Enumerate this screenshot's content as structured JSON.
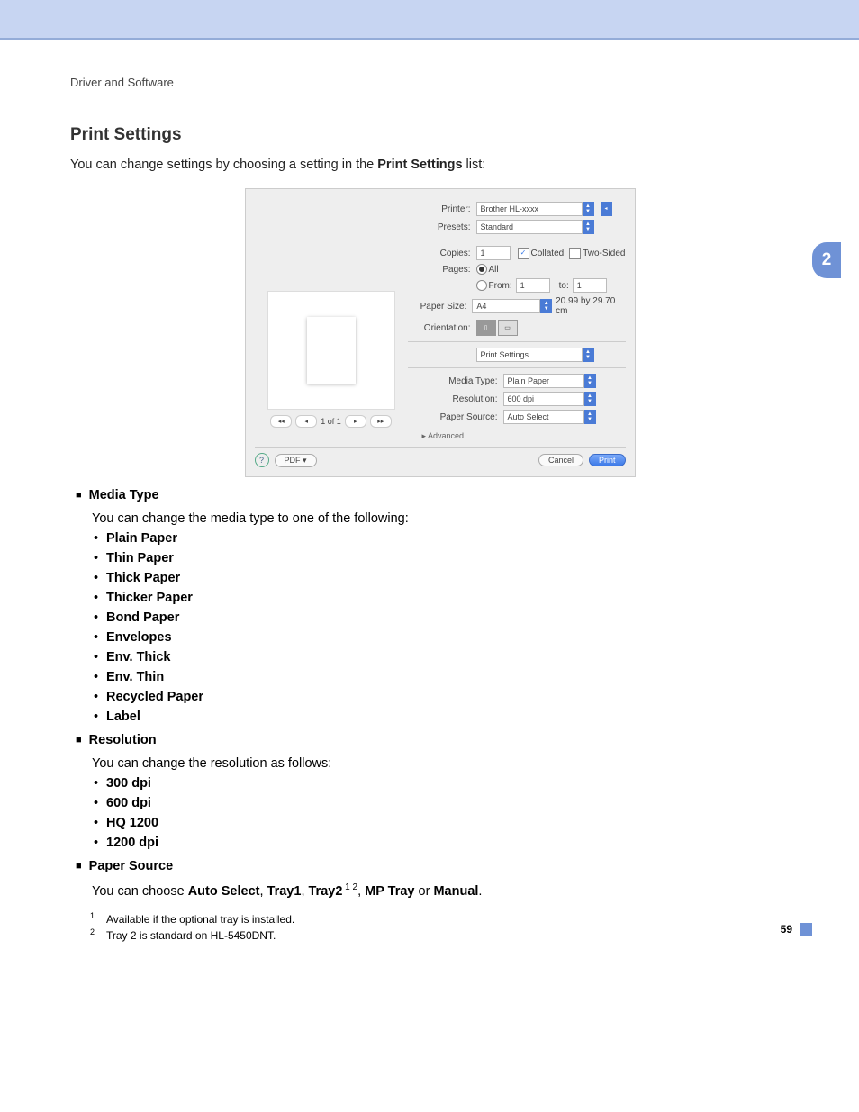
{
  "section_path": "Driver and Software",
  "page_number": "59",
  "chapter_tab": "2",
  "title": "Print Settings",
  "intro_pre": "You can change settings by choosing a setting in the ",
  "intro_bold": "Print Settings",
  "intro_post": " list:",
  "dialog": {
    "printer_label": "Printer:",
    "printer_value": "Brother HL-xxxx",
    "presets_label": "Presets:",
    "presets_value": "Standard",
    "copies_label": "Copies:",
    "copies_value": "1",
    "collated_label": "Collated",
    "twosided_label": "Two-Sided",
    "pages_label": "Pages:",
    "pages_all": "All",
    "pages_from": "From:",
    "pages_from_val": "1",
    "pages_to": "to:",
    "pages_to_val": "1",
    "papersize_label": "Paper Size:",
    "papersize_value": "A4",
    "papersize_dims": "20.99 by 29.70 cm",
    "orientation_label": "Orientation:",
    "pane_select": "Print Settings",
    "media_label": "Media Type:",
    "media_value": "Plain Paper",
    "res_label": "Resolution:",
    "res_value": "600 dpi",
    "src_label": "Paper Source:",
    "src_value": "Auto Select",
    "advanced": "Advanced",
    "pager_text": "1 of 1",
    "pdf_btn": "PDF ▾",
    "cancel_btn": "Cancel",
    "print_btn": "Print"
  },
  "media_type": {
    "heading": "Media Type",
    "intro": "You can change the media type to one of the following:",
    "items": [
      "Plain Paper",
      "Thin Paper",
      "Thick Paper",
      "Thicker Paper",
      "Bond Paper",
      "Envelopes",
      "Env. Thick",
      "Env. Thin",
      "Recycled Paper",
      "Label"
    ]
  },
  "resolution": {
    "heading": "Resolution",
    "intro": "You can change the resolution as follows:",
    "items": [
      "300 dpi",
      "600 dpi",
      "HQ 1200",
      "1200 dpi"
    ]
  },
  "paper_source": {
    "heading": "Paper Source",
    "pre": "You can choose ",
    "opts": [
      "Auto Select",
      "Tray1",
      "Tray2",
      "MP Tray",
      "Manual"
    ],
    "sep1": ", ",
    "sep_or": " or ",
    "period": "."
  },
  "footnotes": {
    "n1": "1",
    "t1": "Available if the optional tray is installed.",
    "n2": "2",
    "t2": "Tray 2 is standard on HL-5450DNT."
  }
}
